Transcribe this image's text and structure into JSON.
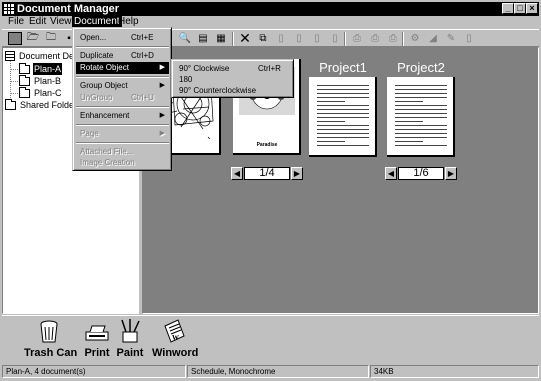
{
  "window": {
    "title": "Document Manager",
    "controls": {
      "minimize": "_",
      "maximize": "□",
      "close": "×"
    }
  },
  "menubar": {
    "items": [
      {
        "id": "file",
        "label": "File"
      },
      {
        "id": "edit",
        "label": "Edit"
      },
      {
        "id": "view",
        "label": "View"
      },
      {
        "id": "document",
        "label": "Document"
      },
      {
        "id": "help",
        "label": "Help"
      }
    ]
  },
  "document_menu": {
    "open": {
      "label": "Open...",
      "shortcut": "Ctrl+E"
    },
    "duplicate": {
      "label": "Duplicate",
      "shortcut": "Ctrl+D"
    },
    "rotate": {
      "label": "Rotate Object"
    },
    "group": {
      "label": "Group Object"
    },
    "ungroup": {
      "label": "UnGroup",
      "shortcut": "Ctrl+U"
    },
    "enhancement": {
      "label": "Enhancement"
    },
    "page": {
      "label": "Page"
    },
    "attached": {
      "label": "Attached File..."
    },
    "image_creation": {
      "label": "Image Creation"
    }
  },
  "rotate_submenu": {
    "cw": {
      "label": "90° Clockwise",
      "shortcut": "Ctrl+R"
    },
    "r180": {
      "label": "180"
    },
    "ccw": {
      "label": "90° Counterclockwise"
    }
  },
  "tree": {
    "root": "Document Desk",
    "items": [
      "Plan-A",
      "Plan-B",
      "Plan-C"
    ],
    "shared": "Shared Folder"
  },
  "main": {
    "documents": [
      {
        "title": "",
        "page": ""
      },
      {
        "title": "",
        "page": "1/4"
      },
      {
        "title": "Project1",
        "page": ""
      },
      {
        "title": "Project2",
        "page": "1/6"
      }
    ],
    "puppy_caption": "Paradise"
  },
  "dock": {
    "items": [
      {
        "label": "Trash Can",
        "icon": "trash-can-icon"
      },
      {
        "label": "Print",
        "icon": "printer-icon"
      },
      {
        "label": "Paint",
        "icon": "paint-icon"
      },
      {
        "label": "Winword",
        "icon": "winword-icon"
      }
    ]
  },
  "statusbar": {
    "folder": "Plan-A, 4 document(s)",
    "info": "Schedule, Monochrome",
    "size": "34KB"
  }
}
